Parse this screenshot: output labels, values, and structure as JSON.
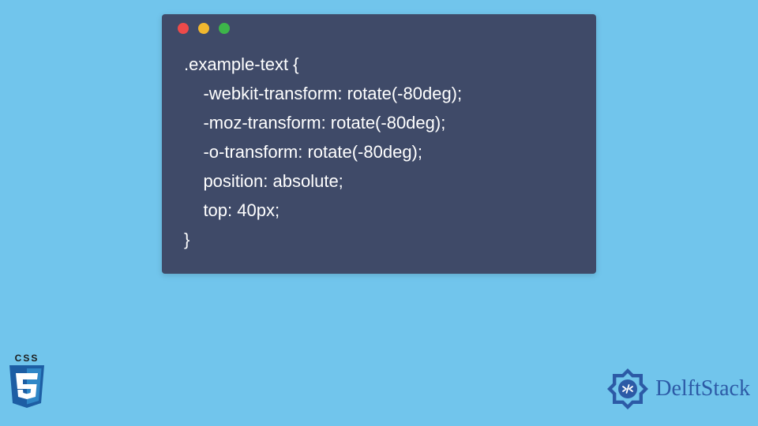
{
  "window": {
    "dots": {
      "red": "#ed4a4a",
      "yellow": "#f1b82f",
      "green": "#3db54a"
    }
  },
  "code": {
    "line1": ".example-text {",
    "line2": "    -webkit-transform: rotate(-80deg);",
    "line3": "    -moz-transform: rotate(-80deg);",
    "line4": "    -o-transform: rotate(-80deg);",
    "line5": "    position: absolute;",
    "line6": "    top: 40px;",
    "line7": "}"
  },
  "css3": {
    "label": "CSS",
    "three": "3"
  },
  "brand": {
    "name": "DelftStack"
  }
}
